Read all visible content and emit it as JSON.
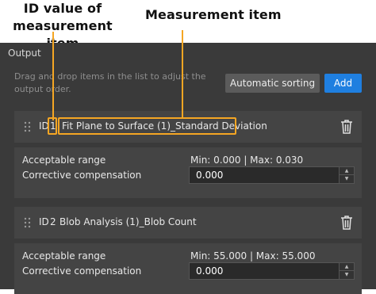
{
  "annotations": {
    "id_label": "ID value of measurement item",
    "measurement_label": "Measurement item"
  },
  "panel": {
    "title": "Output",
    "hint": "Drag and drop items in the list to adjust the output order.",
    "sort_button": "Automatic sorting",
    "add_button": "Add"
  },
  "items": [
    {
      "id_prefix": "ID",
      "id_value": "1",
      "name": "Fit Plane to Surface (1)_Standard Deviation",
      "range_label": "Acceptable range",
      "range_value": "Min: 0.000 | Max: 0.030",
      "comp_label": "Corrective compensation",
      "comp_value": "0.000"
    },
    {
      "id_prefix": "ID",
      "id_value": "2",
      "name": "Blob Analysis (1)_Blob Count",
      "range_label": "Acceptable range",
      "range_value": "Min: 55.000 | Max: 55.000",
      "comp_label": "Corrective compensation",
      "comp_value": "0.000"
    }
  ],
  "icons": {
    "drag": "drag-handle-icon",
    "delete": "trash-icon",
    "spin_up": "chevron-up-icon",
    "spin_down": "chevron-down-icon"
  },
  "colors": {
    "panel_bg": "#3a3a3a",
    "card_bg": "#444444",
    "accent": "#1f7fe0",
    "callout": "#f5a623"
  }
}
